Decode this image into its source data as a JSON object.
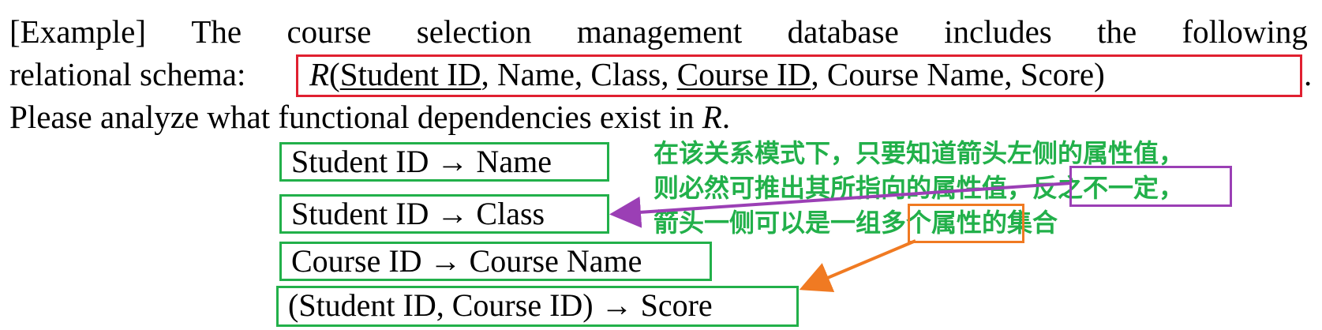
{
  "paragraph": {
    "line1_words": [
      "[Example]",
      "The",
      "course",
      "selection",
      "management",
      "database",
      "includes",
      "the",
      "following"
    ],
    "line2_prefix": "relational schema:",
    "line3_text": "Please analyze what functional dependencies exist in ",
    "line3_R": "R",
    "line3_period": "."
  },
  "schema": {
    "relation_name": "R",
    "open_paren": "(",
    "attr_student_id": "Student ID",
    "sep1": ", Name, Class, ",
    "attr_course_id": "Course ID",
    "tail": ", Course Name, Score)",
    "trailing_period": "."
  },
  "dependencies": [
    "Student ID → Name",
    "Student ID → Class",
    "Course ID → Course Name",
    "(Student ID, Course ID) → Score"
  ],
  "annotation": {
    "line1": "在该关系模式下，只要知道箭头左侧的属性值，",
    "line2_a": "则必然可推出其所指向的属性值，",
    "line2_b": "反之不一定，",
    "line3_a": "箭头一侧可以是一组",
    "line3_b": "多个属性",
    "line3_c": "的集合"
  },
  "colors": {
    "schema_box": "#e02030",
    "dependency_box": "#22b04a",
    "annotation_text": "#22b04a",
    "purple_highlight": "#9b3fb5",
    "orange_highlight": "#f07a22"
  }
}
